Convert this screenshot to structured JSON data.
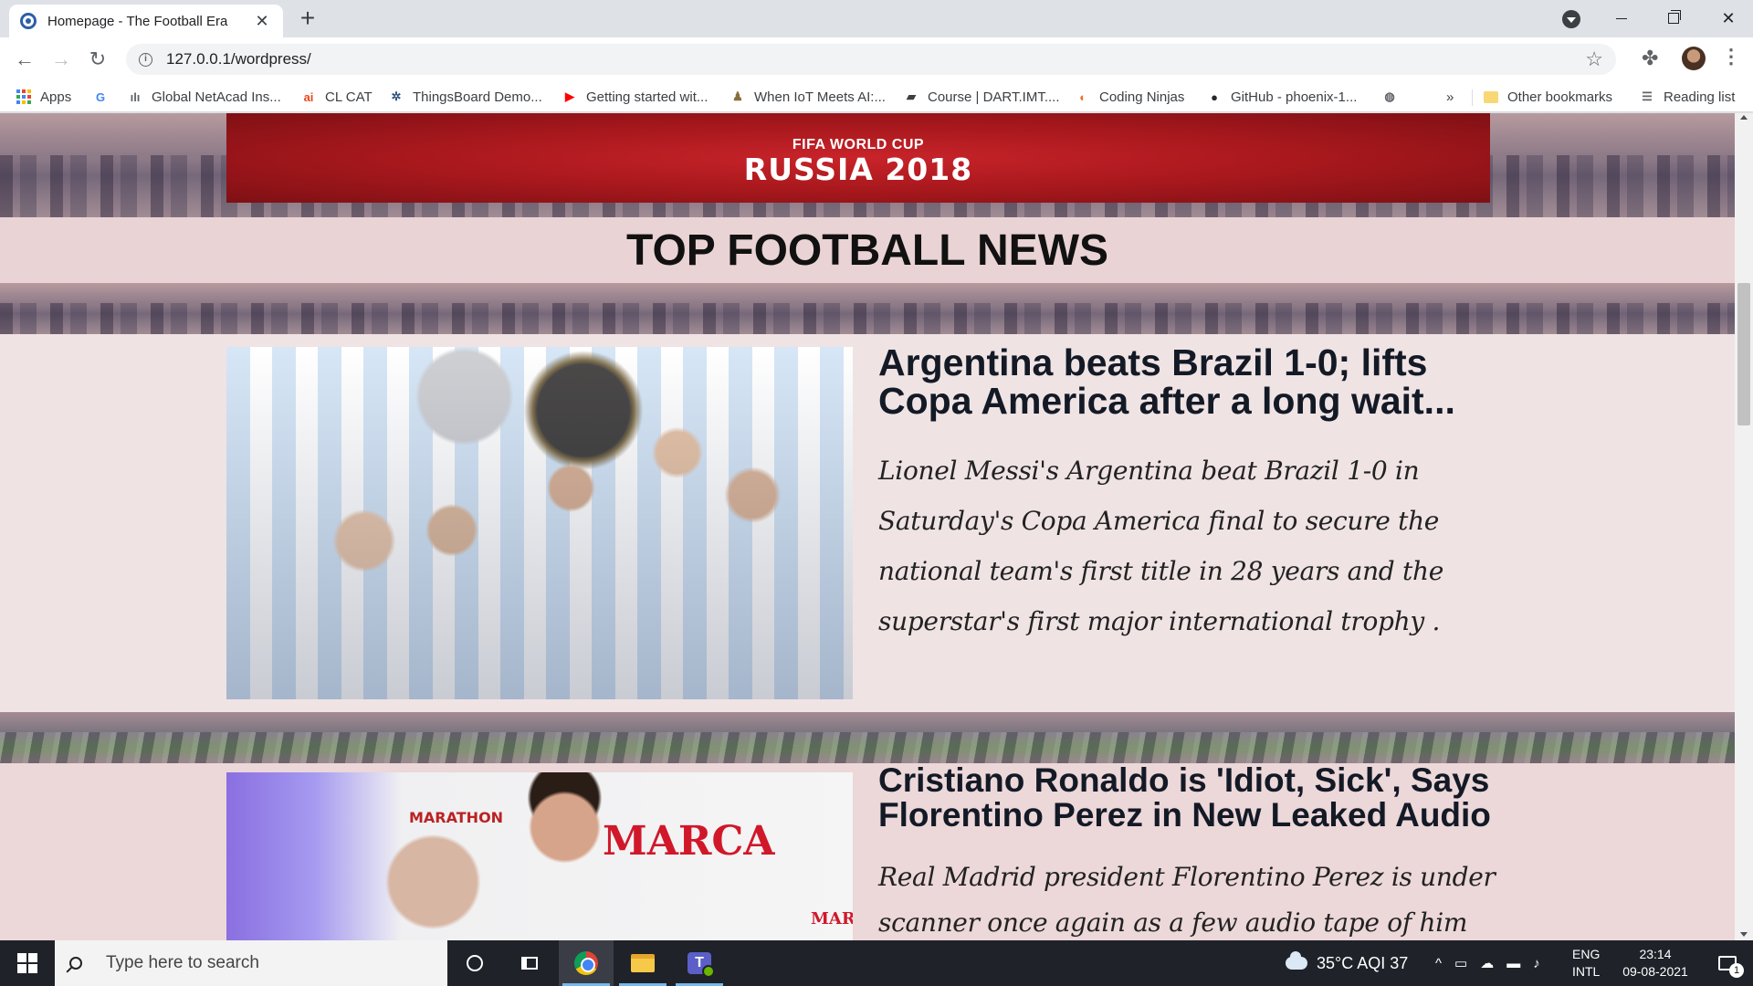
{
  "browser": {
    "tab": {
      "title": "Homepage - The Football Era",
      "close_glyph": "✕"
    },
    "new_tab_glyph": "+",
    "url": "127.0.0.1/wordpress/",
    "bookmarks": [
      {
        "label": "Apps",
        "icon": "apps-grid-icon"
      },
      {
        "label": "",
        "icon": "google-icon",
        "glyph": "G",
        "color": "#4285f4"
      },
      {
        "label": "Global NetAcad Ins...",
        "icon": "cisco-icon",
        "glyph": "ılı",
        "color": "#5f6368"
      },
      {
        "label": "CL CAT",
        "icon": "ai-icon",
        "glyph": "ai",
        "color": "#e8491d"
      },
      {
        "label": "ThingsBoard Demo...",
        "icon": "thingsboard-icon",
        "glyph": "✲",
        "color": "#305680"
      },
      {
        "label": "Getting started wit...",
        "icon": "youtube-icon",
        "glyph": "▶",
        "color": "#ff0000"
      },
      {
        "label": "When IoT Meets AI:...",
        "icon": "iot-icon",
        "glyph": "♟",
        "color": "#8a6d3b"
      },
      {
        "label": "Course | DART.IMT....",
        "icon": "dart-icon",
        "glyph": "▰",
        "color": "#3c4043"
      },
      {
        "label": "Coding Ninjas",
        "icon": "coding-ninjas-icon",
        "glyph": "◐",
        "color": "#f26c22"
      },
      {
        "label": "GitHub - phoenix-1...",
        "icon": "github-icon",
        "glyph": "●",
        "color": "#24292e"
      },
      {
        "label": "",
        "icon": "globe-icon",
        "glyph": "◍",
        "color": "#5f6368"
      }
    ],
    "more_glyph": "»",
    "other_bookmarks": "Other bookmarks",
    "reading_list": "Reading list"
  },
  "page": {
    "banner_small": "FIFA WORLD CUP",
    "banner_big": "RUSSIA 2018",
    "section_title": "TOP FOOTBALL NEWS",
    "articles": [
      {
        "headline": "Argentina beats Brazil 1-0; lifts Copa America after a long wait...",
        "excerpt": "Lionel Messi's Argentina beat Brazil 1-0 in Saturday's Copa America final to secure the national team's first title in 28 years and the superstar's first major international trophy ."
      },
      {
        "headline": "Cristiano Ronaldo is 'Idiot, Sick', Says Florentino Perez in New Leaked Audio",
        "excerpt": "Real Madrid president Florentino Perez is under scanner once again as a few audio tape of him was leaked where he can be",
        "image_text": {
          "marca": "MARCA",
          "marathon": "MARATHON",
          "marca_small": "MAR"
        }
      }
    ]
  },
  "taskbar": {
    "search_placeholder": "Type here to search",
    "weather": "35°C  AQI 37",
    "lang_top": "ENG",
    "lang_bottom": "INTL",
    "time": "23:14",
    "date": "09-08-2021",
    "notification_count": "1"
  },
  "colors": {
    "banner_red": "#c8242a",
    "section_band": "#ead3d4",
    "taskbar": "#1f2229"
  }
}
